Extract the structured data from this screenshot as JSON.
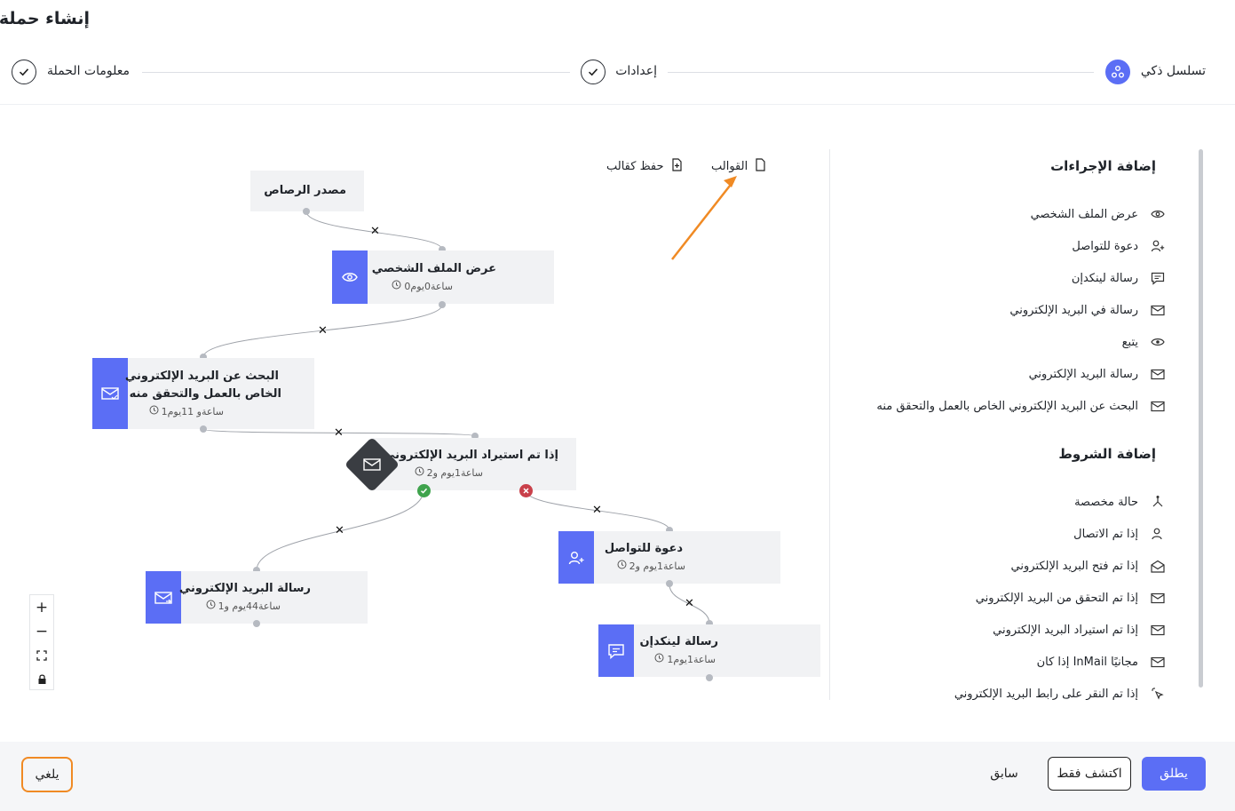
{
  "page": {
    "title": "إنشاء حملة"
  },
  "steps": [
    {
      "label": "تسلسل ذكي",
      "state": "active"
    },
    {
      "label": "إعدادات",
      "state": "done"
    },
    {
      "label": "معلومات الحملة",
      "state": "done"
    }
  ],
  "toolbar": {
    "templates_label": "القوالب",
    "save_as_template_label": "حفظ كقالب"
  },
  "flow": {
    "source": "مصدر الرصاص",
    "view_profile": {
      "title": "عرض الملف الشخصي",
      "delay": "ساعة0يوم0"
    },
    "find_email": {
      "title_line1": "البحث عن البريد الإلكتروني",
      "title_line2": "الخاص بالعمل والتحقق منه",
      "delay": "ساعةو 11يوم1"
    },
    "if_email_imported": {
      "title": "إذا تم استيراد البريد الإلكتروني",
      "delay": "ساعة1يوم و2"
    },
    "email_message": {
      "title": "رسالة البريد الإلكتروني",
      "delay": "ساعة44يوم و1"
    },
    "invite": {
      "title": "دعوة للتواصل",
      "delay": "ساعة1يوم و2"
    },
    "linkedin_message": {
      "title": "رسالة لينكدإن",
      "delay": "ساعة1يوم1"
    }
  },
  "zoom_controls": {
    "zoom_in": "+",
    "zoom_out": "−"
  },
  "actions_panel": {
    "actions_title": "إضافة الإجراءات",
    "actions": [
      {
        "label": "عرض الملف الشخصي",
        "icon": "eye-icon"
      },
      {
        "label": "دعوة للتواصل",
        "icon": "user-plus-icon"
      },
      {
        "label": "رسالة لينكدإن",
        "icon": "chat-icon"
      },
      {
        "label": "رسالة في البريد الإلكتروني",
        "icon": "mail-send-icon"
      },
      {
        "label": "يتبع",
        "icon": "eye-follow-icon"
      },
      {
        "label": "رسالة البريد الإلكتروني",
        "icon": "mail-send-icon"
      },
      {
        "label": "البحث عن البريد الإلكتروني الخاص بالعمل والتحقق منه",
        "icon": "mail-check-icon"
      }
    ],
    "conditions_title": "إضافة الشروط",
    "conditions": [
      {
        "label": "حالة مخصصة",
        "icon": "branch-icon"
      },
      {
        "label": "إذا تم الاتصال",
        "icon": "user-icon"
      },
      {
        "label": "إذا تم فتح البريد الإلكتروني",
        "icon": "mail-open-icon"
      },
      {
        "label": "إذا تم التحقق من البريد الإلكتروني",
        "icon": "mail-check-icon"
      },
      {
        "label": "إذا تم استيراد البريد الإلكتروني",
        "icon": "mail-import-icon"
      },
      {
        "label": "مجانيًا InMail إذا كان",
        "icon": "mail-free-icon"
      },
      {
        "label": "إذا تم النقر على رابط البريد الإلكتروني",
        "icon": "click-icon"
      }
    ]
  },
  "footer": {
    "cancel_label": "يلغي",
    "previous_label": "سابق",
    "explore_only_label": "اكتشف فقط",
    "launch_label": "يطلق"
  },
  "colors": {
    "accent": "#5b6ef5",
    "dark_node": "#3a3d42",
    "success": "#3fa34d",
    "danger": "#c9404a",
    "highlight": "#f08a24"
  }
}
